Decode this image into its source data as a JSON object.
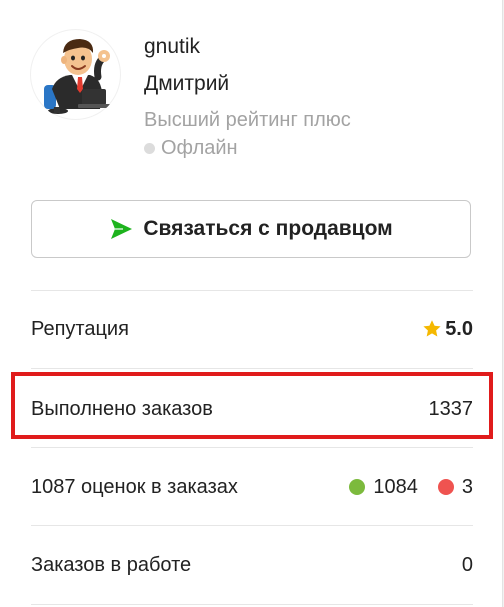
{
  "profile": {
    "username": "gnutik",
    "name": "Дмитрий",
    "rating_title": "Высший рейтинг плюс",
    "status": "Офлайн"
  },
  "contact_button": {
    "label": "Связаться с продавцом",
    "icon": "send-icon",
    "icon_color": "#1db31d"
  },
  "stats": {
    "reputation": {
      "label": "Репутация",
      "value": "5.0",
      "icon": "star-icon",
      "icon_color": "#f5b800"
    },
    "orders_done": {
      "label": "Выполнено заказов",
      "value": "1337"
    },
    "reviews": {
      "label": "1087 оценок в заказах",
      "positive": "1084",
      "negative": "3",
      "positive_color": "#7cba3d",
      "negative_color": "#ef5350"
    },
    "orders_in_progress": {
      "label": "Заказов в работе",
      "value": "0"
    }
  },
  "colors": {
    "highlight": "#e01b1b",
    "muted": "#a3a3a3"
  }
}
